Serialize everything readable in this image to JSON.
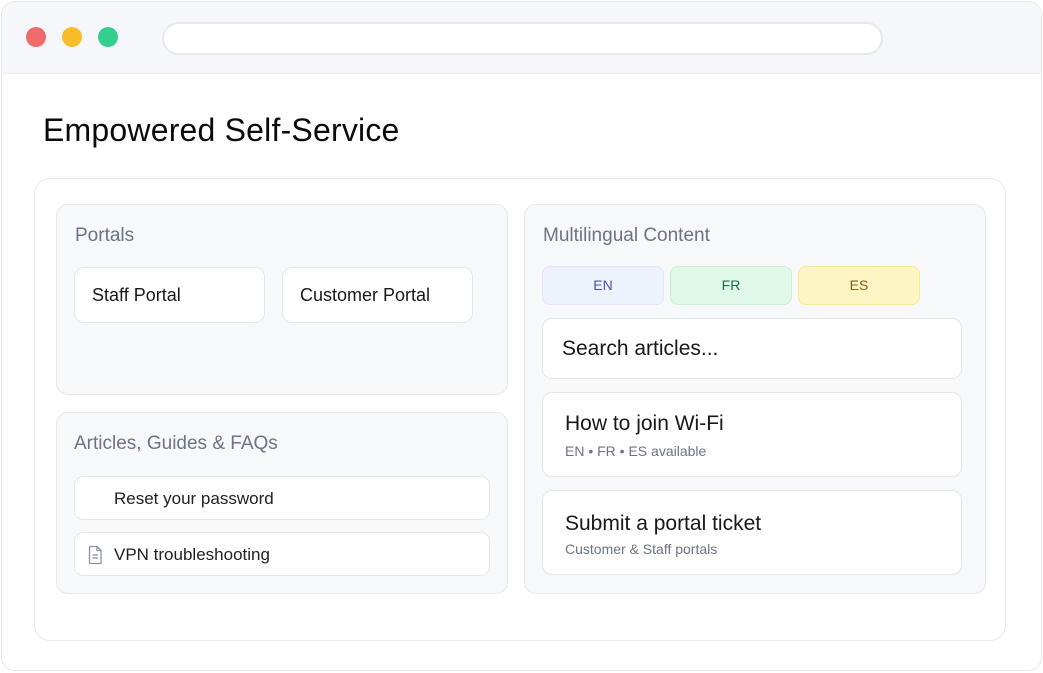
{
  "page": {
    "title": "Empowered Self-Service"
  },
  "portals": {
    "title": "Portals",
    "items": [
      {
        "label": "Staff Portal"
      },
      {
        "label": "Customer Portal"
      }
    ]
  },
  "articles": {
    "title": "Articles, Guides & FAQs",
    "items": [
      {
        "label": "Reset your password",
        "icon": ""
      },
      {
        "label": "VPN troubleshooting",
        "icon": "document-icon"
      }
    ]
  },
  "multilingual": {
    "title": "Multilingual Content",
    "languages": [
      {
        "label": "EN",
        "bg": "#eef2fd",
        "border": "#dfe6fb",
        "color": "#4a55a8"
      },
      {
        "label": "FR",
        "bg": "#e0f8ea",
        "border": "#c8efd8",
        "color": "#1f6a45"
      },
      {
        "label": "ES",
        "bg": "#fdf6c4",
        "border": "#f4e89b",
        "color": "#8a5a14"
      }
    ],
    "search_placeholder": "Search articles...",
    "results": [
      {
        "title": "How to join Wi-Fi",
        "subtitle": "EN • FR • ES available"
      },
      {
        "title": "Submit a portal ticket",
        "subtitle": "Customer & Staff portals"
      }
    ]
  },
  "colors": {
    "traffic_red": "#f06b6b",
    "traffic_yellow": "#f8bd2a",
    "traffic_green": "#34cf8f"
  }
}
